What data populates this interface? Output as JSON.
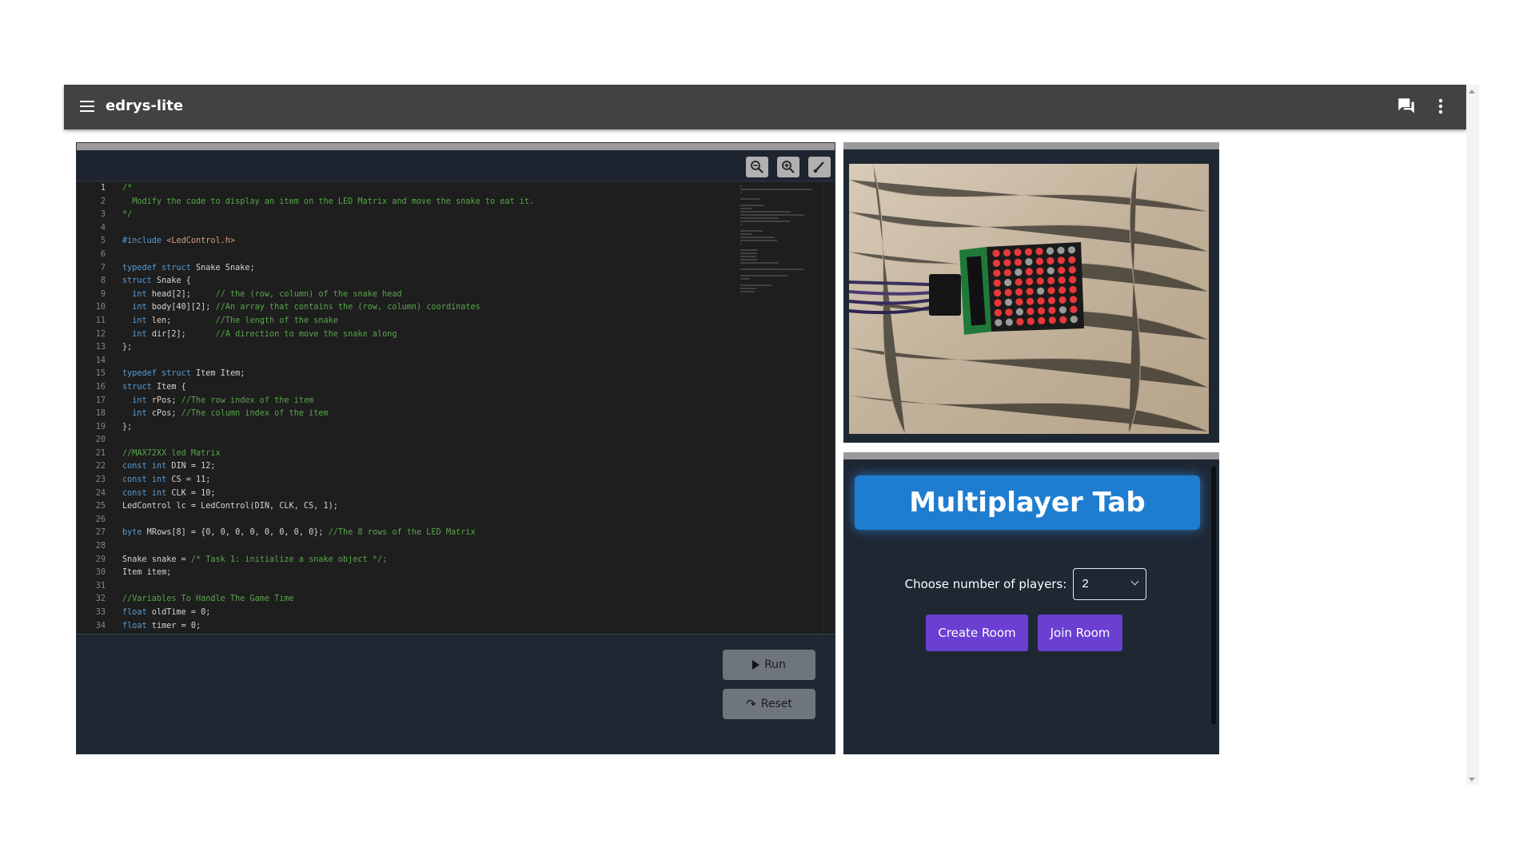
{
  "header": {
    "title": "edrys-lite",
    "menu_icon": "menu-icon",
    "chat_icon": "chat-icon",
    "more_icon": "more-vert-icon"
  },
  "editor": {
    "toolbar_icons": [
      "zoom-out-icon",
      "zoom-in-icon",
      "brush-icon"
    ],
    "lines": [
      "/*",
      "  Modify the code to display an item on the LED Matrix and move the snake to eat it.",
      "*/",
      "",
      "#include <LedControl.h>",
      "",
      "typedef struct Snake Snake;",
      "struct Snake {",
      "  int head[2];     // the (row, column) of the snake head",
      "  int body[40][2]; //An array that contains the (row, column) coordinates",
      "  int len;         //The length of the snake",
      "  int dir[2];      //A direction to move the snake along",
      "};",
      "",
      "typedef struct Item Item;",
      "struct Item {",
      "  int rPos; //The row index of the item",
      "  int cPos; //The column index of the item",
      "};",
      "",
      "//MAX72XX led Matrix",
      "const int DIN = 12;",
      "const int CS = 11;",
      "const int CLK = 10;",
      "LedControl lc = LedControl(DIN, CLK, CS, 1);",
      "",
      "byte MRows[8] = {0, 0, 0, 0, 0, 0, 0, 0}; //The 8 rows of the LED Matrix",
      "",
      "Snake snake = /* Task 1: initialize a snake object */;",
      "Item item;",
      "",
      "//Variables To Handle The Game Time",
      "float oldTime = 0;",
      "float timer = 0;"
    ]
  },
  "actions": {
    "run_label": "Run",
    "reset_label": "Reset"
  },
  "multiplayer": {
    "title": "Multiplayer Tab",
    "players_label": "Choose number of players:",
    "players_value": "2",
    "create_room_label": "Create Room",
    "join_room_label": "Join Room"
  },
  "colors": {
    "topbar": "#424242",
    "panel": "#1f2733",
    "accent_blue": "#1f7dd0",
    "accent_purple": "#6a3fd1"
  }
}
